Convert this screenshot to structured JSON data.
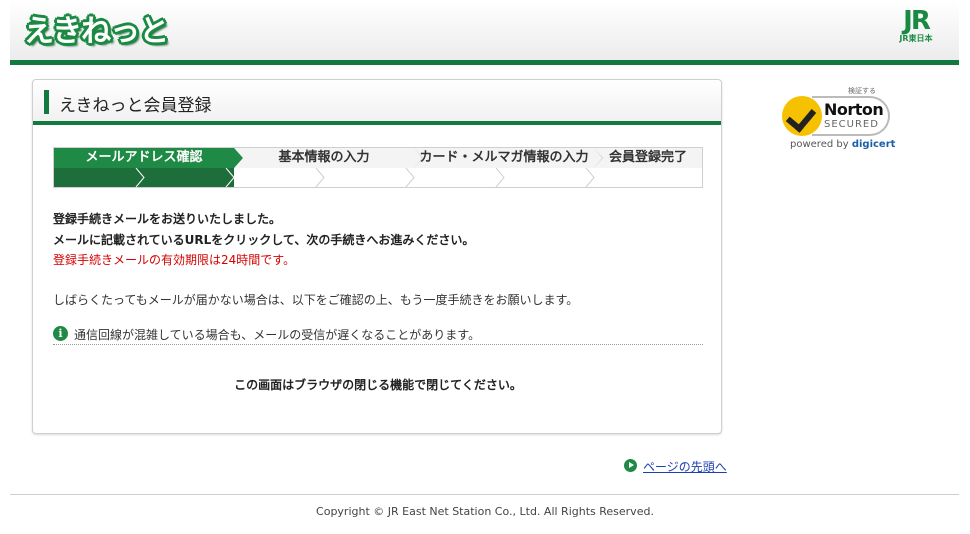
{
  "header": {
    "logo_text": "えきねっと",
    "jr_logo_mark": "JR",
    "jr_logo_sub": "JR東日本"
  },
  "panel": {
    "title": "えきねっと会員登録",
    "steps": [
      {
        "label": "メールアドレス確認",
        "active": true
      },
      {
        "label": "基本情報の入力",
        "active": false
      },
      {
        "label": "カード・メルマガ情報の入力",
        "active": false
      },
      {
        "label": "会員登録完了",
        "active": false
      }
    ],
    "progress": {
      "completed_segments": 2,
      "total_segments": 7
    },
    "message_line1": "登録手続きメールをお送りいたしました。",
    "message_line2": "メールに記載されているURLをクリックして、次の手続きへお進みください。",
    "expiry_notice": "登録手続きメールの有効期限は24時間です。",
    "retry_notice": "しばらくたってもメールが届かない場合は、以下をご確認の上、もう一度手続きをお願いします。",
    "info_note": "通信回線が混雑している場合も、メールの受信が遅くなることがあります。",
    "info_icon_glyph": "i",
    "close_instruction": "この画面はブラウザの閉じる機能で閉じてください。"
  },
  "norton": {
    "verify_label": "検証する",
    "name": "Norton",
    "secured": "SECURED",
    "powered_by": "powered by",
    "brand": "digicert"
  },
  "footer": {
    "page_top_link": "ページの先頭へ",
    "copyright": "Copyright © JR East Net Station Co., Ltd. All Rights Reserved."
  },
  "colors": {
    "brand_green": "#137a3f",
    "step_active": "#1e8a45",
    "alert_red": "#d40000",
    "link_blue": "#1a3fb0"
  }
}
